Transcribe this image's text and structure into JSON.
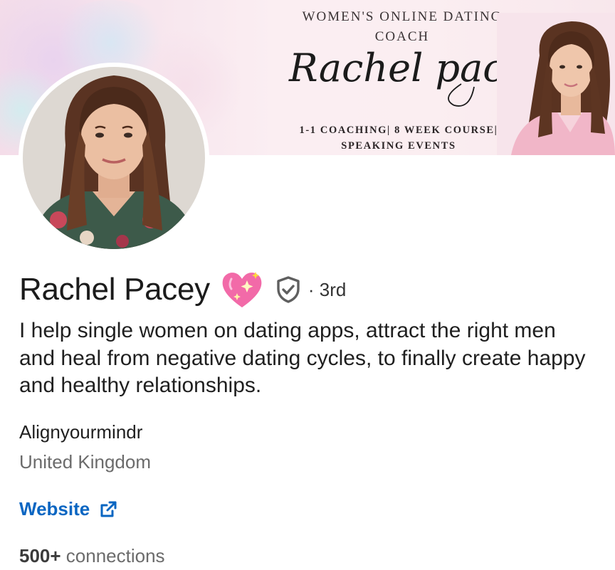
{
  "banner": {
    "heading_line1": "WOMEN'S ONLINE DATING",
    "heading_line2": "COACH",
    "script_name": "Rachel pacey",
    "services_line1": "1-1 COACHING| 8 WEEK COURSE|",
    "services_line2": "SPEAKING EVENTS"
  },
  "profile": {
    "name": "Rachel Pacey",
    "name_emoji": "sparkling-heart-icon",
    "verified_icon": "verified-shield-icon",
    "degree": "· 3rd",
    "headline": "I help single women on dating apps, attract the right men and heal from negative dating cycles, to finally create happy and healthy relationships.",
    "company": "Alignyourmindr",
    "location": "United Kingdom",
    "website_label": "Website",
    "website_icon": "external-link-icon",
    "connections_count": "500+",
    "connections_label": " connections"
  },
  "colors": {
    "link": "#0a66c2",
    "secondary_text": "#6b6b6b",
    "heart": "#f26aa8"
  }
}
